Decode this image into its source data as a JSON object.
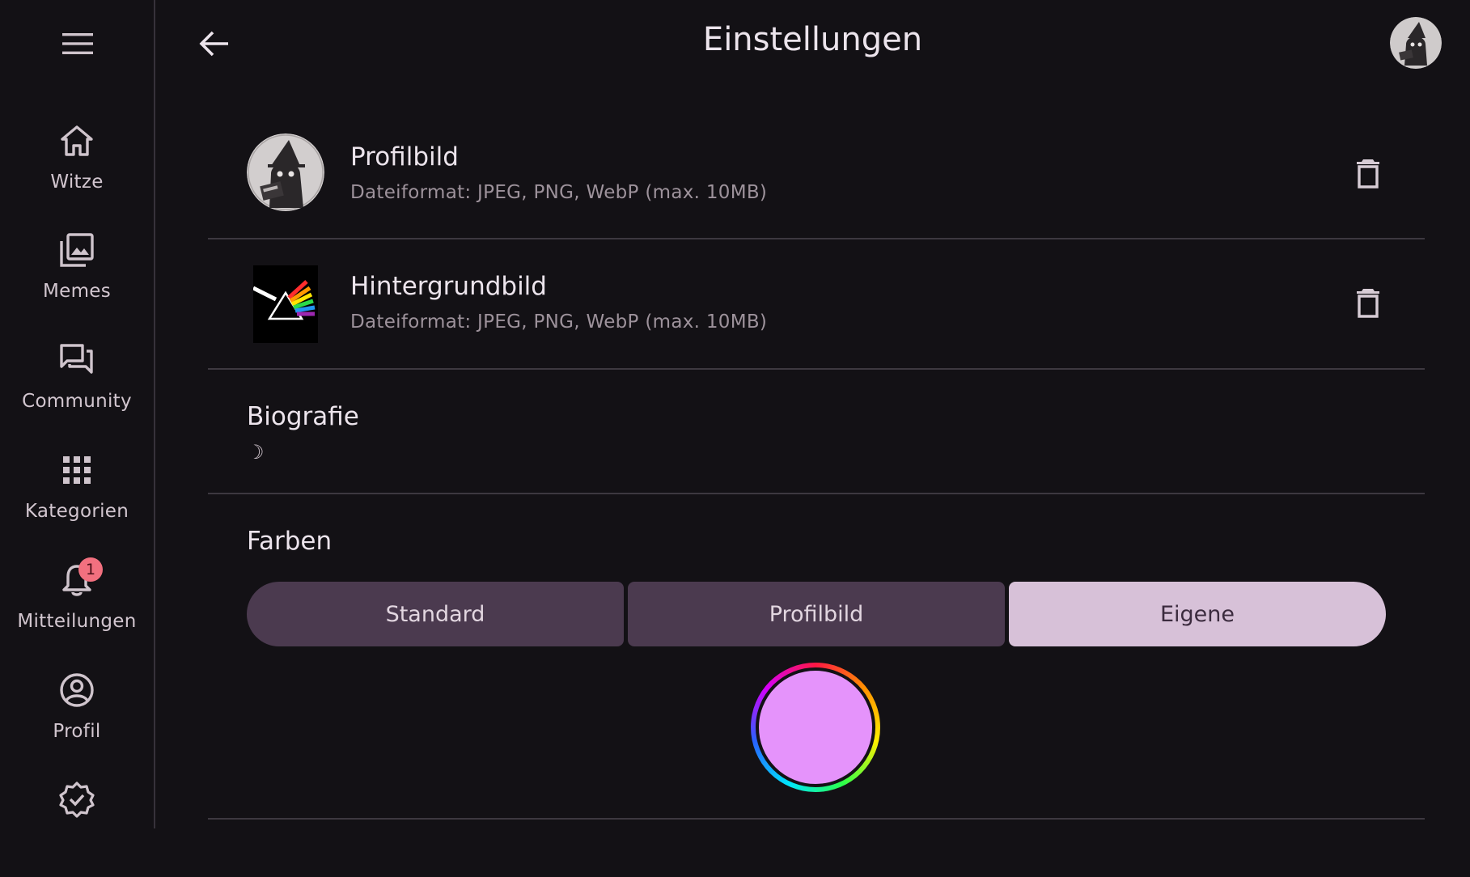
{
  "nav": {
    "items": [
      {
        "label": "Witze",
        "icon": "home-icon"
      },
      {
        "label": "Memes",
        "icon": "photo-library-icon"
      },
      {
        "label": "Community",
        "icon": "forum-icon"
      },
      {
        "label": "Kategorien",
        "icon": "apps-grid-icon"
      },
      {
        "label": "Mitteilungen",
        "icon": "bell-icon",
        "badge": "1"
      },
      {
        "label": "Profil",
        "icon": "account-circle-icon"
      },
      {
        "label": "",
        "icon": "verified-badge-icon"
      }
    ]
  },
  "header": {
    "title": "Einstellungen"
  },
  "settings": {
    "profile_image": {
      "title": "Profilbild",
      "subtitle": "Dateiformat: JPEG, PNG, WebP (max. 10MB)"
    },
    "background_image": {
      "title": "Hintergrundbild",
      "subtitle": "Dateiformat: JPEG, PNG, WebP (max. 10MB)"
    },
    "bio": {
      "title": "Biografie",
      "value": "☽"
    },
    "colors": {
      "title": "Farben",
      "options": [
        "Standard",
        "Profilbild",
        "Eigene"
      ],
      "selected": "Eigene",
      "custom_color": "#e593fb"
    }
  },
  "colors": {
    "background": "#131115",
    "accent": "#d7c1d8",
    "segment": "#4b3a4f",
    "badge": "#f2707f"
  }
}
